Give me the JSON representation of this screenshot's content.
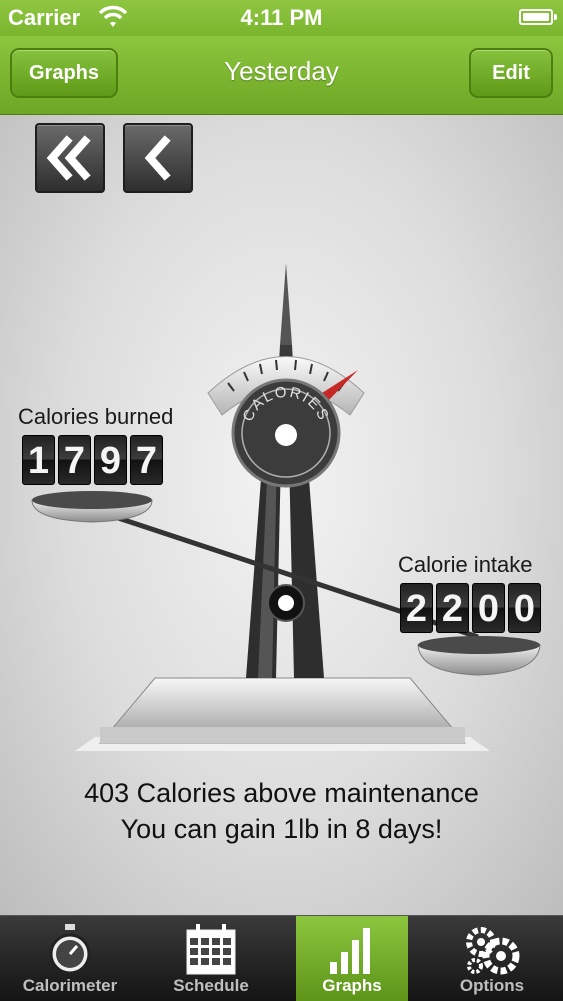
{
  "status_bar": {
    "carrier": "Carrier",
    "time": "4:11 PM"
  },
  "nav": {
    "left_button": "Graphs",
    "title": "Yesterday",
    "right_button": "Edit"
  },
  "controls": {
    "first_icon": "double-chevron-left-icon",
    "prev_icon": "chevron-left-icon"
  },
  "scale": {
    "dial_label": "CALORIES",
    "burned_label": "Calories burned",
    "burned_digits": [
      "1",
      "7",
      "9",
      "7"
    ],
    "intake_label": "Calorie intake",
    "intake_digits": [
      "2",
      "2",
      "0",
      "0"
    ]
  },
  "summary": {
    "line1": "403 Calories above maintenance",
    "line2": "You can gain 1lb in 8 days!"
  },
  "tabs": [
    {
      "label": "Calorimeter",
      "icon": "stopwatch-icon",
      "selected": false
    },
    {
      "label": "Schedule",
      "icon": "calendar-icon",
      "selected": false
    },
    {
      "label": "Graphs",
      "icon": "bar-chart-icon",
      "selected": true
    },
    {
      "label": "Options",
      "icon": "gears-icon",
      "selected": false
    }
  ],
  "colors": {
    "accent": "#7ab52e",
    "needle": "#c62828"
  }
}
